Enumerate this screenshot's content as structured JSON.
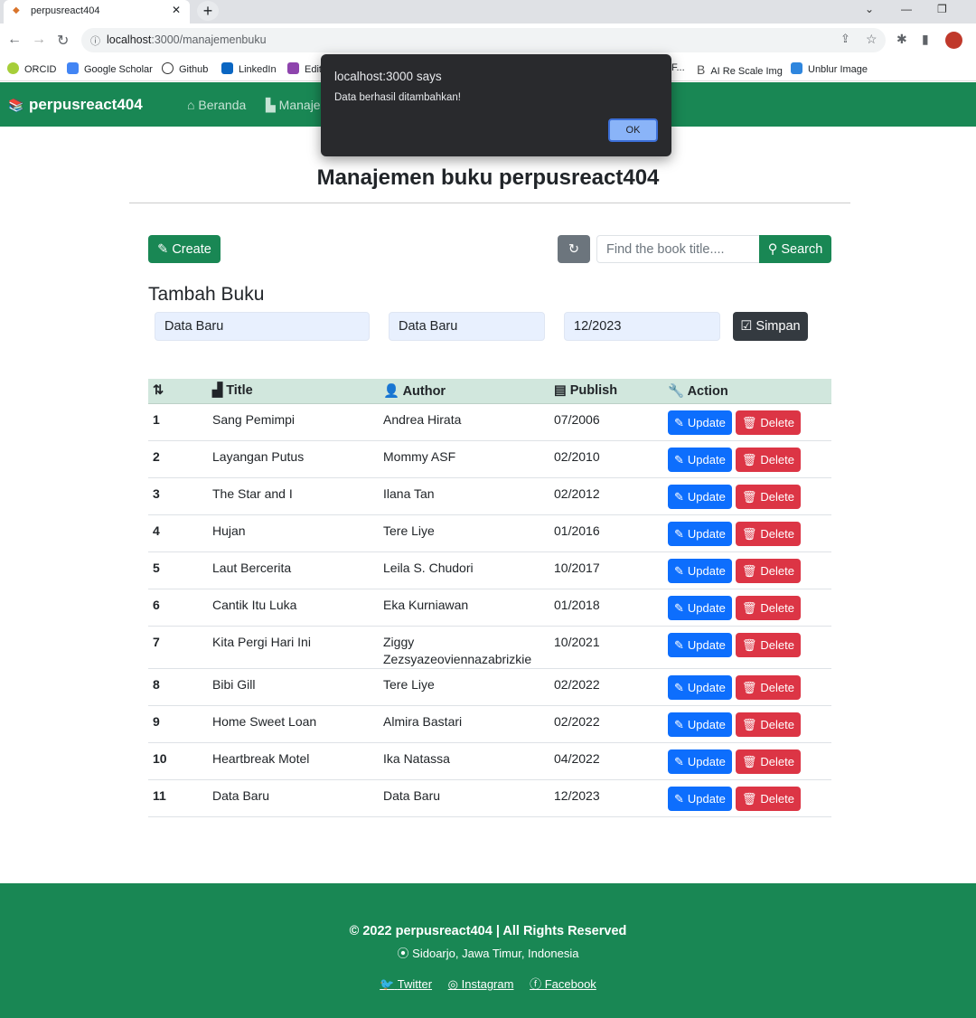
{
  "browser": {
    "tab_title": "perpusreact404",
    "url_host": "localhost",
    "url_path": ":3000/manajemenbuku",
    "bookmarks": [
      "ORCID",
      "Google Scholar",
      "Github",
      "LinkedIn",
      "Edit",
      "F...",
      "AI Re Scale Img",
      "Unblur Image"
    ]
  },
  "nav": {
    "brand": "perpusreact404",
    "links": [
      "Beranda",
      "Manajemen Buku"
    ]
  },
  "page": {
    "title": "Manajemen buku perpusreact404",
    "create": "Create",
    "search_placeholder": "Find the book title....",
    "search": "Search",
    "form_title": "Tambah Buku",
    "title_value": "Data Baru",
    "author_value": "Data Baru",
    "publish_value": "12/2023",
    "save": "Simpan"
  },
  "table": {
    "headers": [
      "",
      "Title",
      "Author",
      "Publish",
      "Action"
    ],
    "update": "Update",
    "delete": "Delete",
    "rows": [
      [
        "1",
        "Sang Pemimpi",
        "Andrea Hirata",
        "07/2006"
      ],
      [
        "2",
        "Layangan Putus",
        "Mommy ASF",
        "02/2010"
      ],
      [
        "3",
        "The Star and I",
        "Ilana Tan",
        "02/2012"
      ],
      [
        "4",
        "Hujan",
        "Tere Liye",
        "01/2016"
      ],
      [
        "5",
        "Laut Bercerita",
        "Leila S. Chudori",
        "10/2017"
      ],
      [
        "6",
        "Cantik Itu Luka",
        "Eka Kurniawan",
        "01/2018"
      ],
      [
        "7",
        "Kita Pergi Hari Ini",
        "Ziggy Zezsyazeoviennazabrizkie",
        "10/2021"
      ],
      [
        "8",
        "Bibi Gill",
        "Tere Liye",
        "02/2022"
      ],
      [
        "9",
        "Home Sweet Loan",
        "Almira Bastari",
        "02/2022"
      ],
      [
        "10",
        "Heartbreak Motel",
        "Ika Natassa",
        "04/2022"
      ],
      [
        "11",
        "Data Baru",
        "Data Baru",
        "12/2023"
      ]
    ]
  },
  "footer": {
    "copyright": "© 2022 perpusreact404 | All Rights Reserved",
    "location": "Sidoarjo, Jawa Timur, Indonesia",
    "links": [
      "Twitter",
      "Instagram",
      "Facebook"
    ]
  },
  "dialog": {
    "title": "localhost:3000 says",
    "message": "Data berhasil ditambahkan!",
    "ok": "OK"
  },
  "colors": {
    "primary": "#198754",
    "update": "#0d6efd",
    "delete": "#dc3545"
  }
}
